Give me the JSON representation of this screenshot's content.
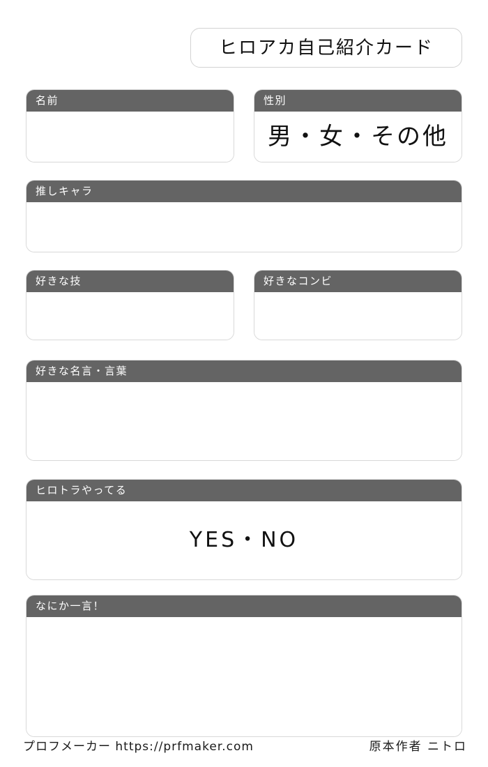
{
  "card": {
    "title": "ヒロアカ自己紹介カード",
    "fields": [
      {
        "key": "name",
        "label": "名前",
        "value": ""
      },
      {
        "key": "gender",
        "label": "性別",
        "value": "男・女・その他"
      },
      {
        "key": "oshi",
        "label": "推しキャラ",
        "value": ""
      },
      {
        "key": "waza",
        "label": "好きな技",
        "value": ""
      },
      {
        "key": "combi",
        "label": "好きなコンビ",
        "value": ""
      },
      {
        "key": "meigen",
        "label": "好きな名言・言葉",
        "value": ""
      },
      {
        "key": "hirotora",
        "label": "ヒロトラやってる",
        "value": "YES・NO"
      },
      {
        "key": "hitokoto",
        "label": "なにか一言！",
        "value": ""
      }
    ]
  },
  "footer": {
    "left": "プロフメーカー https://prfmaker.com",
    "right": "原本作者 ニトロ"
  },
  "colors": {
    "header_bar": "#646464",
    "header_text": "#ffffff",
    "card_border": "#d8d8d8",
    "title_border": "#d2d2d2",
    "body_text": "#111111",
    "background": "#ffffff"
  }
}
